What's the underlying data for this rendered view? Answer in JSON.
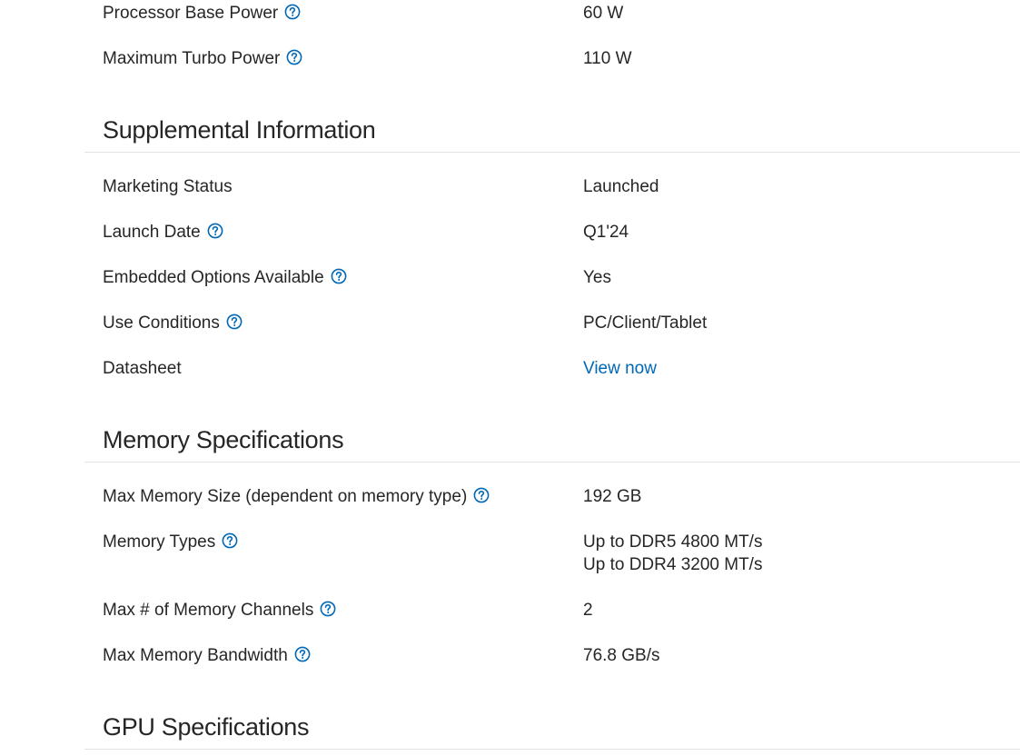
{
  "sections": [
    {
      "title": "",
      "rows": [
        {
          "label": "Processor Base Power",
          "value": "60 W",
          "help": true
        },
        {
          "label": "Maximum Turbo Power",
          "value": "110 W",
          "help": true
        }
      ]
    },
    {
      "title": "Supplemental Information",
      "rows": [
        {
          "label": "Marketing Status",
          "value": "Launched",
          "help": false
        },
        {
          "label": "Launch Date",
          "value": "Q1'24",
          "help": true
        },
        {
          "label": "Embedded Options Available",
          "value": "Yes",
          "help": true
        },
        {
          "label": "Use Conditions",
          "value": "PC/Client/Tablet",
          "help": true
        },
        {
          "label": "Datasheet",
          "value": "View now",
          "help": false,
          "link": true
        }
      ]
    },
    {
      "title": "Memory Specifications",
      "rows": [
        {
          "label": "Max Memory Size (dependent on memory type)",
          "value": "192 GB",
          "help": true
        },
        {
          "label": "Memory Types",
          "value_lines": [
            "Up to DDR5 4800 MT/s",
            "Up to DDR4 3200 MT/s"
          ],
          "help": true
        },
        {
          "label": "Max # of Memory Channels",
          "value": "2",
          "help": true
        },
        {
          "label": "Max Memory Bandwidth",
          "value": "76.8 GB/s",
          "help": true
        }
      ]
    },
    {
      "title": "GPU Specifications",
      "rows": []
    }
  ],
  "icons": {
    "help": "question-circle-icon"
  },
  "colors": {
    "accent": "#0068b5",
    "text": "#262626",
    "rule": "#e2e2e2"
  }
}
